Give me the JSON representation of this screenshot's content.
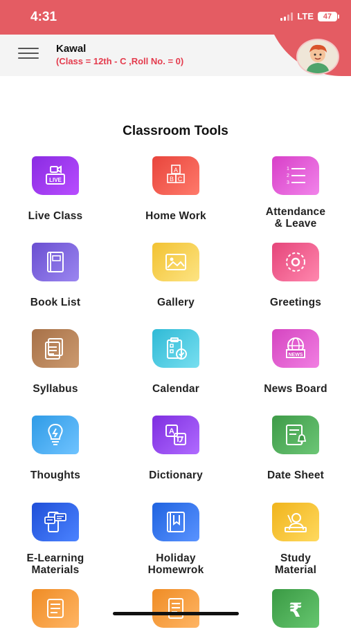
{
  "status_bar": {
    "time": "4:31",
    "network": "LTE",
    "battery": "47"
  },
  "header": {
    "name": "Kawal",
    "class_info": "(Class = 12th - C ,Roll No. = 0)"
  },
  "section_title": "Classroom Tools",
  "tools": [
    {
      "label": "Live Class",
      "icon": "live-class-icon",
      "color": "#8a2be2",
      "color2": "#b84dff"
    },
    {
      "label": "Home Work",
      "icon": "abc-blocks-icon",
      "color": "#e8453c",
      "color2": "#ff7a6b"
    },
    {
      "label": "Attendance\n& Leave",
      "icon": "numbered-list-icon",
      "color": "#d83fc8",
      "color2": "#f184ea"
    },
    {
      "label": "Book List",
      "icon": "book-icon",
      "color": "#6a4fd1",
      "color2": "#9b86f0"
    },
    {
      "label": "Gallery",
      "icon": "image-icon",
      "color": "#f2c232",
      "color2": "#fde483"
    },
    {
      "label": "Greetings",
      "icon": "greeting-icon",
      "color": "#e5457a",
      "color2": "#ff87ae"
    },
    {
      "label": "Syllabus",
      "icon": "documents-icon",
      "color": "#a77148",
      "color2": "#cc9a6f"
    },
    {
      "label": "Calendar",
      "icon": "clipboard-check-icon",
      "color": "#2fbad6",
      "color2": "#78dff0"
    },
    {
      "label": "News Board",
      "icon": "news-globe-icon",
      "color": "#d545c1",
      "color2": "#f17fe2"
    },
    {
      "label": "Thoughts",
      "icon": "lightbulb-icon",
      "color": "#2f9be6",
      "color2": "#6fc3ff"
    },
    {
      "label": "Dictionary",
      "icon": "translate-icon",
      "color": "#7e2ee0",
      "color2": "#b06bff"
    },
    {
      "label": "Date Sheet",
      "icon": "date-sheet-icon",
      "color": "#3e9b48",
      "color2": "#6cc676"
    },
    {
      "label": "E-Learning\nMaterials",
      "icon": "e-learning-icon",
      "color": "#1f4fd8",
      "color2": "#4b83ff"
    },
    {
      "label": "Holiday\nHomewrok",
      "icon": "holiday-book-icon",
      "color": "#1f63e0",
      "color2": "#5a93ff"
    },
    {
      "label": "Study\nMaterial",
      "icon": "study-material-icon",
      "color": "#f0b41c",
      "color2": "#ffd95e"
    },
    {
      "label": "",
      "icon": "scroll-icon",
      "color": "#ef8c25",
      "color2": "#ffb564"
    },
    {
      "label": "",
      "icon": "document-icon",
      "color": "#ef8c25",
      "color2": "#ffb564"
    },
    {
      "label": "",
      "icon": "rupee-icon",
      "color": "#3a9a44",
      "color2": "#66c66f"
    }
  ]
}
